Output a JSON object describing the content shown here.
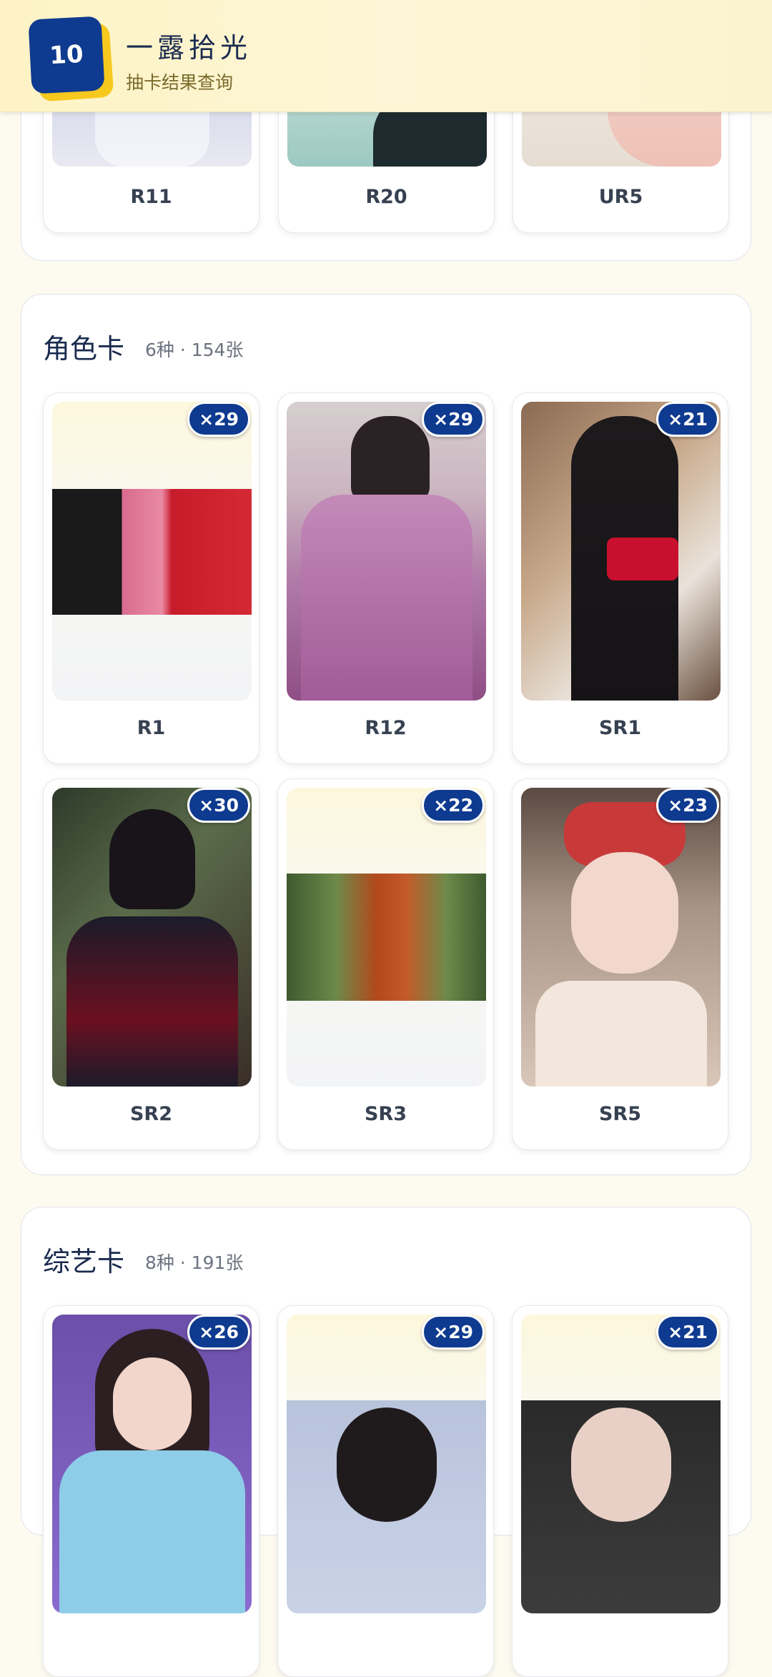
{
  "header": {
    "logo_number": "10",
    "title": "一露拾光",
    "subtitle": "抽卡结果查询"
  },
  "top_section": {
    "cards": [
      {
        "label": "R11"
      },
      {
        "label": "R20"
      },
      {
        "label": "UR5"
      }
    ]
  },
  "role_section": {
    "title": "角色卡",
    "meta": "6种 · 154张",
    "cards": [
      {
        "label": "R1",
        "count": "×29"
      },
      {
        "label": "R12",
        "count": "×29"
      },
      {
        "label": "SR1",
        "count": "×21"
      },
      {
        "label": "SR2",
        "count": "×30"
      },
      {
        "label": "SR3",
        "count": "×22"
      },
      {
        "label": "SR5",
        "count": "×23"
      }
    ]
  },
  "variety_section": {
    "title": "综艺卡",
    "meta": "8种 · 191张",
    "cards": [
      {
        "count": "×26"
      },
      {
        "count": "×29"
      },
      {
        "count": "×21"
      }
    ]
  },
  "colors": {
    "brand_blue": "#0e3a8f",
    "brand_yellow": "#f7c81d",
    "page_bg": "#fdfbf0"
  }
}
